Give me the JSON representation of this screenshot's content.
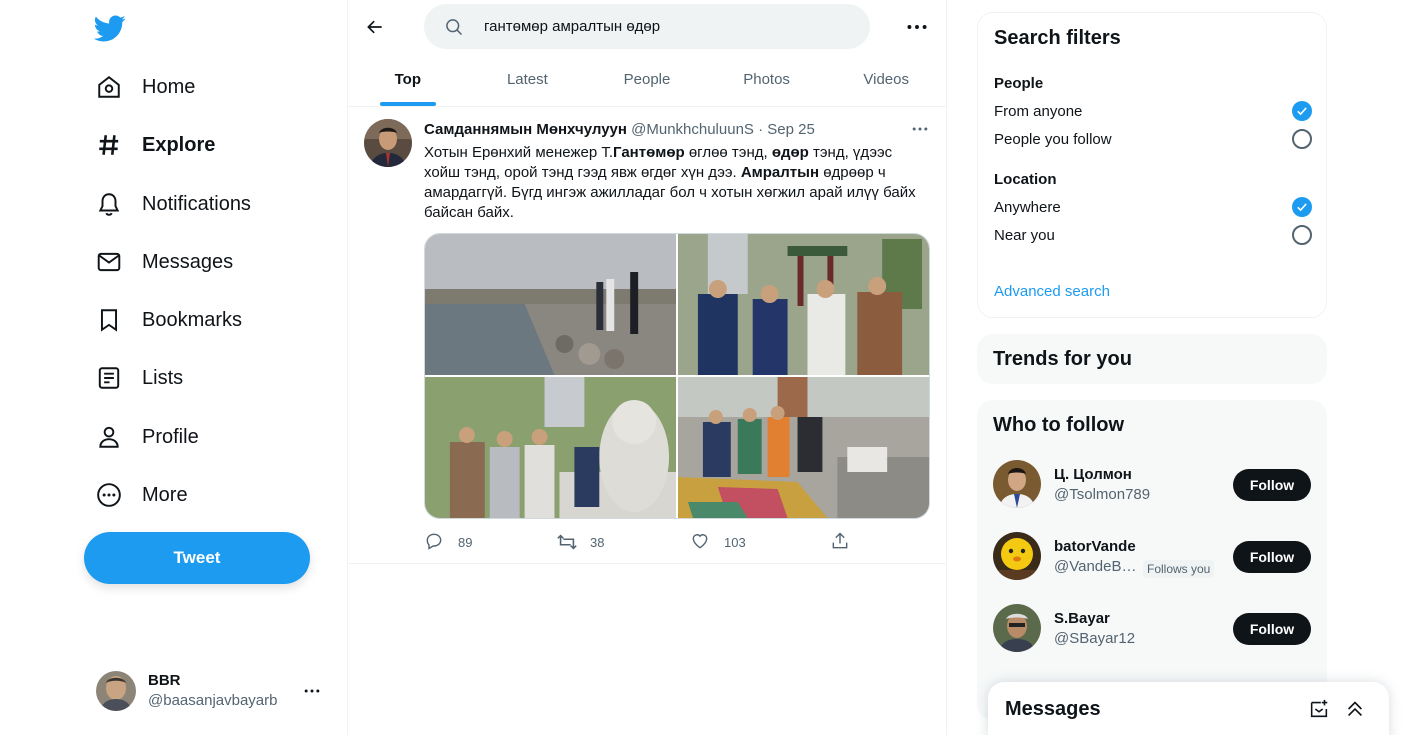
{
  "nav": {
    "items": [
      {
        "label": "Home",
        "icon": "home-icon"
      },
      {
        "label": "Explore",
        "icon": "hashtag-icon"
      },
      {
        "label": "Notifications",
        "icon": "bell-icon"
      },
      {
        "label": "Messages",
        "icon": "envelope-icon"
      },
      {
        "label": "Bookmarks",
        "icon": "bookmark-icon"
      },
      {
        "label": "Lists",
        "icon": "list-icon"
      },
      {
        "label": "Profile",
        "icon": "person-icon"
      },
      {
        "label": "More",
        "icon": "more-circle-icon"
      }
    ],
    "active": "Explore",
    "tweet_label": "Tweet",
    "account": {
      "name": "BBR",
      "handle": "@baasanjavbayarb"
    }
  },
  "search": {
    "query": "гантөмөр амралтын өдөр",
    "tabs": [
      "Top",
      "Latest",
      "People",
      "Photos",
      "Videos"
    ],
    "active_tab": "Top"
  },
  "tweet": {
    "name": "Самданнямын Мөнхчулуун",
    "handle": "@MunkhchuluunS",
    "separator": "·",
    "date": "Sep 25",
    "text": {
      "p1": "Хотын Ерөнхий менежер Т.",
      "b1": "Гантөмөр",
      "p2": " өглөө тэнд, ",
      "b2": "өдөр",
      "p3": " тэнд, үдээс хойш тэнд, орой тэнд гээд явж өгдөг хүн дээ. ",
      "b3": "Амралтын",
      "p4": " өдрөөр ч амардаггүй. Бүгд ингэж ажилладаг бол ч хотын хөгжил арай илүү байх байсан байх."
    },
    "stats": {
      "replies": "89",
      "retweets": "38",
      "likes": "103"
    }
  },
  "filters": {
    "title": "Search filters",
    "people_label": "People",
    "people_options": [
      {
        "label": "From anyone",
        "checked": true
      },
      {
        "label": "People you follow",
        "checked": false
      }
    ],
    "location_label": "Location",
    "location_options": [
      {
        "label": "Anywhere",
        "checked": true
      },
      {
        "label": "Near you",
        "checked": false
      }
    ],
    "advanced_link": "Advanced search"
  },
  "trends": {
    "title": "Trends for you"
  },
  "who_to_follow": {
    "title": "Who to follow",
    "follow_label": "Follow",
    "users": [
      {
        "name": "Ц. Цолмон",
        "handle": "@Tsolmon789"
      },
      {
        "name": "batorVande",
        "handle": "@VandeB…",
        "badge": "Follows you"
      },
      {
        "name": "S.Bayar",
        "handle": "@SBayar12"
      }
    ]
  },
  "messages_drawer": {
    "title": "Messages"
  },
  "colors": {
    "accent": "#1d9bf0",
    "text": "#0f1419",
    "secondary": "#536471",
    "border": "#eff3f4"
  }
}
